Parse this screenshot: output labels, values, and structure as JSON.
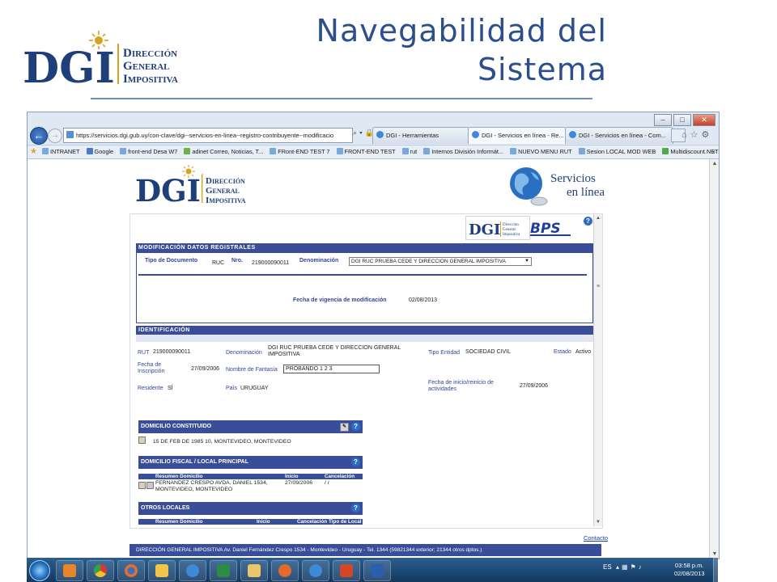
{
  "slide": {
    "title_line1": "Navegabilidad del",
    "title_line2": "Sistema",
    "logo": {
      "abbr": "DGI",
      "line1": "Dirección",
      "line2": "General",
      "line3": "Impositiva"
    }
  },
  "browser": {
    "address": "https://servicios.dgi.gub.uy/con-clave/dgi--servicios-en-linea--registro-contribuyente--modificacio",
    "tabs": [
      {
        "label": "DGI - Herramientas",
        "active": false
      },
      {
        "label": "DGI - Servicios en línea - Re...",
        "active": true
      },
      {
        "label": "DGI - Servicios en línea - Com...",
        "active": false
      }
    ],
    "favorites": [
      "INTRANET",
      "Google",
      "front-end Desa W7",
      "adinet Correo, Noticias, T...",
      "FRont-END TEST 7",
      "FRONT-END TEST",
      "rut",
      "Internos División Informát...",
      "NUEVO MENU RUT",
      "Sesion LOCAL MOD WEB",
      "Multidiscount.NET - Disc..."
    ],
    "more": "»"
  },
  "site": {
    "logo": {
      "abbr": "DGI",
      "line1": "Dirección",
      "line2": "General",
      "line3": "Impositiva"
    },
    "servicios_line1": "Servicios",
    "servicios_line2": "en línea"
  },
  "app": {
    "mini_logo": {
      "abbr": "DGI",
      "line1": "Dirección",
      "line2": "General",
      "line3": "Impositiva"
    },
    "bps": "BPS",
    "help": "?",
    "modificacion": {
      "header": "MODIFICACIÓN DATOS REGISTRALES",
      "tipo_documento_label": "Tipo de Documento",
      "tipo_documento_value": "RUC",
      "nro_label": "Nro.",
      "nro_value": "219000090011",
      "denominacion_label": "Denominación",
      "denominacion_select": "DGI RUC PRUEBA CEDE Y DIRECCION GENERAL IMPOSITIVA",
      "fecha_vigencia_label": "Fecha de vigencia de modificación",
      "fecha_vigencia_value": "02/08/2013"
    },
    "identificacion": {
      "header": "IDENTIFICACIÓN",
      "ruc_label": "RUT",
      "ruc_value": "219000090011",
      "denominacion_label": "Denominación",
      "denominacion_value": "DGI RUC PRUEBA CEDE Y DIRECCION GENERAL IMPOSITIVA",
      "tipo_entidad_label": "Tipo Entidad",
      "tipo_entidad_value": "SOCIEDAD CIVIL",
      "estado_label": "Estado",
      "estado_value": "Activo",
      "fecha_inscripcion_label": "Fecha de Inscripción",
      "fecha_inscripcion_value": "27/09/2006",
      "nombre_fantasia_label": "Nombre de Fantasía",
      "nombre_fantasia_value": "PROBANDO 1 2 3",
      "fecha_inicio_label": "Fecha de inicio/reinicio de actividades",
      "fecha_inicio_value": "27/09/2006",
      "residente_label": "Residente",
      "residente_value": "SÍ",
      "pais_label": "País",
      "pais_value": "URUGUAY"
    },
    "domicilio_constituido": {
      "header": "DOMICILIO CONSTITUIDO",
      "address": "15 DE FEB DE 1985 10, MONTEVIDEO, MONTEVIDEO"
    },
    "domicilio_fiscal": {
      "header": "DOMICILIO FISCAL / LOCAL PRINCIPAL",
      "columns": [
        "Resumen Domicilio",
        "Inicio",
        "Cancelación"
      ],
      "rows": [
        {
          "resumen": "FERNANDEZ CRESPO AVDA. DANIEL 1534, MONTEVIDEO, MONTEVIDEO",
          "inicio": "27/09/2006",
          "cancelacion": "/ /"
        }
      ]
    },
    "otros_locales": {
      "header": "OTROS LOCALES",
      "columns": [
        "Resumen Domicilio",
        "Inicio",
        "Cancelación",
        "Tipo de Local"
      ]
    },
    "footer": "DIRECCIÓN GENERAL IMPOSITIVA Av. Daniel Fernández Crespo 1534 - Montevideo - Uruguay - Tel. 1344 (59821344 exterior; 21344 otros dptos.)",
    "contacto": "Contacto"
  },
  "taskbar": {
    "lang": "ES",
    "time": "03:58 p.m.",
    "date": "02/08/2013"
  },
  "colors": {
    "slide_title": "#2c4f8c",
    "dgi_blue": "#1f3f7a",
    "dgi_gold": "#d9a21b",
    "section_bar": "#3a4d99",
    "label_blue": "#31469a"
  }
}
